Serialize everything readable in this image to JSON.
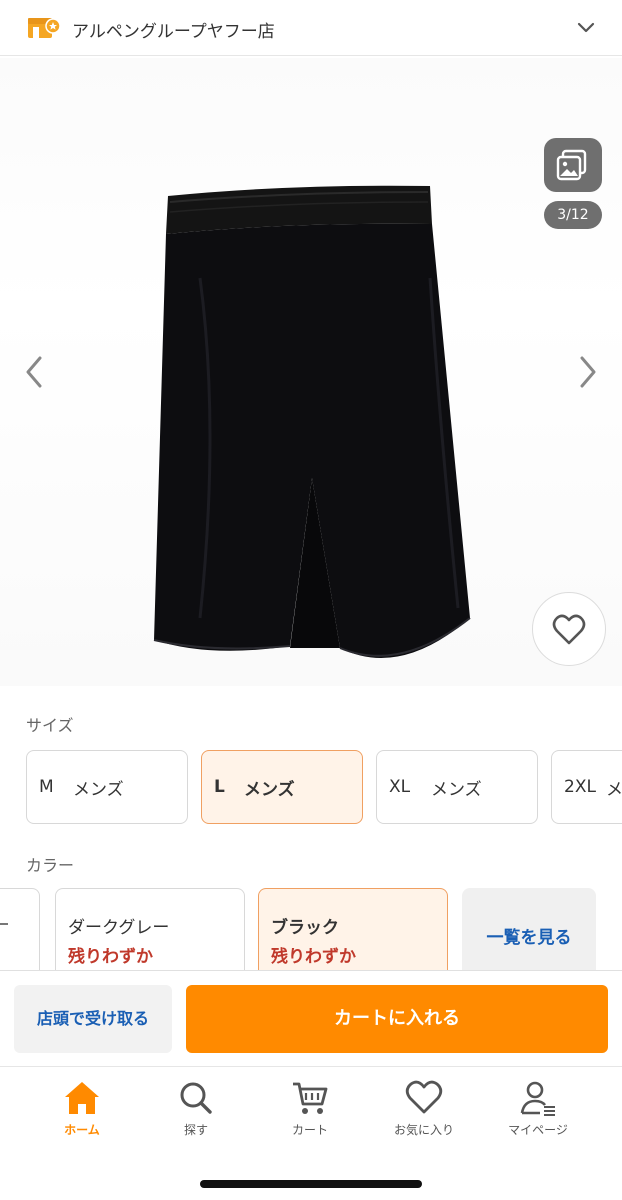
{
  "header": {
    "store_name": "アルペングループヤフー店"
  },
  "gallery": {
    "page_indicator": "3/12"
  },
  "size": {
    "label": "サイズ",
    "options": [
      {
        "size": "M",
        "gender": "メンズ"
      },
      {
        "size": "L",
        "gender": "メンズ"
      },
      {
        "size": "XL",
        "gender": "メンズ"
      },
      {
        "size": "2XL",
        "gender": "メ"
      }
    ],
    "selected": "L"
  },
  "color": {
    "label": "カラー",
    "options": [
      {
        "name": "ダークグレー",
        "stock": "残りわずか"
      },
      {
        "name": "ブラック",
        "stock": "残りわずか"
      }
    ],
    "selected": "ブラック",
    "see_all": "一覧を見る"
  },
  "actions": {
    "pickup": "店頭で受け取る",
    "add_to_cart": "カートに入れる"
  },
  "nav": {
    "items": [
      {
        "label": "ホーム",
        "icon": "home-icon"
      },
      {
        "label": "探す",
        "icon": "search-icon"
      },
      {
        "label": "カート",
        "icon": "cart-icon"
      },
      {
        "label": "お気に入り",
        "icon": "heart-icon"
      },
      {
        "label": "マイページ",
        "icon": "user-icon"
      }
    ]
  },
  "colors": {
    "accent": "#ff8a00",
    "link": "#1a5fb4",
    "warning": "#c0392b",
    "selected_bg": "#fff3e8",
    "selected_border": "#f0a062"
  }
}
